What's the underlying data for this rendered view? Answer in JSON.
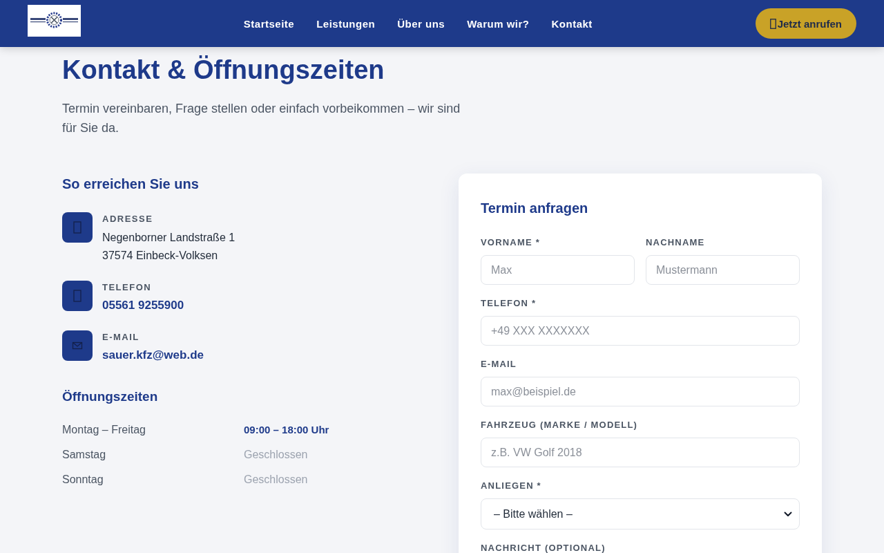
{
  "header": {
    "nav": [
      {
        "label": "Startseite"
      },
      {
        "label": "Leistungen"
      },
      {
        "label": "Über uns"
      },
      {
        "label": "Warum wir?"
      },
      {
        "label": "Kontakt"
      }
    ],
    "call_button": {
      "label": "Jetzt anrufen"
    }
  },
  "intro": {
    "title": "Kontakt & Öffnungszeiten",
    "subtitle": "Termin vereinbaren, Frage stellen oder einfach vorbeikommen – wir sind für Sie da."
  },
  "contact": {
    "heading": "So erreichen Sie uns",
    "items": [
      {
        "kind": "address",
        "label": "ADRESSE",
        "lines": [
          "Negenborner Landstraße 1",
          "37574 Einbeck-Volksen"
        ]
      },
      {
        "kind": "phone",
        "label": "TELEFON",
        "value": "05561 9255900"
      },
      {
        "kind": "email",
        "label": "E-MAIL",
        "value": "sauer.kfz@web.de"
      }
    ]
  },
  "hours": {
    "heading": "Öffnungszeiten",
    "rows": [
      {
        "day": "Montag – Freitag",
        "time": "09:00 – 18:00 Uhr",
        "open": true
      },
      {
        "day": "Samstag",
        "time": "Geschlossen",
        "open": false
      },
      {
        "day": "Sonntag",
        "time": "Geschlossen",
        "open": false
      }
    ]
  },
  "form": {
    "title": "Termin anfragen",
    "rows": [
      {
        "fields": [
          {
            "kind": "text",
            "label": "VORNAME *",
            "placeholder": "Max"
          },
          {
            "kind": "text",
            "label": "NACHNAME",
            "placeholder": "Mustermann"
          }
        ]
      },
      {
        "fields": [
          {
            "kind": "text",
            "label": "TELEFON *",
            "placeholder": "+49 XXX XXXXXXX"
          }
        ]
      },
      {
        "fields": [
          {
            "kind": "text",
            "label": "E-MAIL",
            "placeholder": "max@beispiel.de"
          }
        ]
      },
      {
        "fields": [
          {
            "kind": "text",
            "label": "FAHRZEUG (MARKE / MODELL)",
            "placeholder": "z.B. VW Golf 2018"
          }
        ]
      },
      {
        "fields": [
          {
            "kind": "select",
            "label": "ANLIEGEN *",
            "value": "– Bitte wählen –"
          }
        ]
      },
      {
        "fields": [
          {
            "kind": "textarea",
            "label": "NACHRICHT (OPTIONAL)"
          }
        ]
      }
    ]
  }
}
